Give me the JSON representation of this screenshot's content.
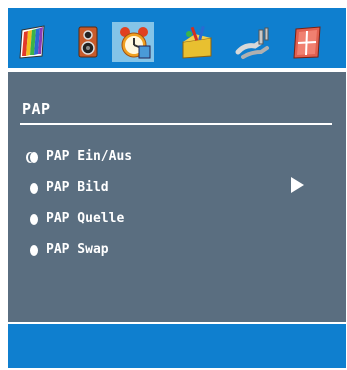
{
  "icon_bar": {
    "tabs": [
      {
        "name": "picture-icon"
      },
      {
        "name": "sound-icon"
      },
      {
        "name": "timer-icon",
        "selected": true
      },
      {
        "name": "features-icon"
      },
      {
        "name": "source-icon"
      },
      {
        "name": "setup-icon"
      }
    ]
  },
  "menu": {
    "title": "PAP",
    "items": [
      {
        "label": "PAP Ein/Aus",
        "active": true
      },
      {
        "label": "PAP Bild",
        "has_submenu": true
      },
      {
        "label": "PAP Quelle"
      },
      {
        "label": "PAP Swap"
      }
    ]
  },
  "colors": {
    "bar": "#0f7fcf",
    "panel": "#5a6e80",
    "selected_tab": "#84c4e8",
    "text": "#ffffff"
  }
}
